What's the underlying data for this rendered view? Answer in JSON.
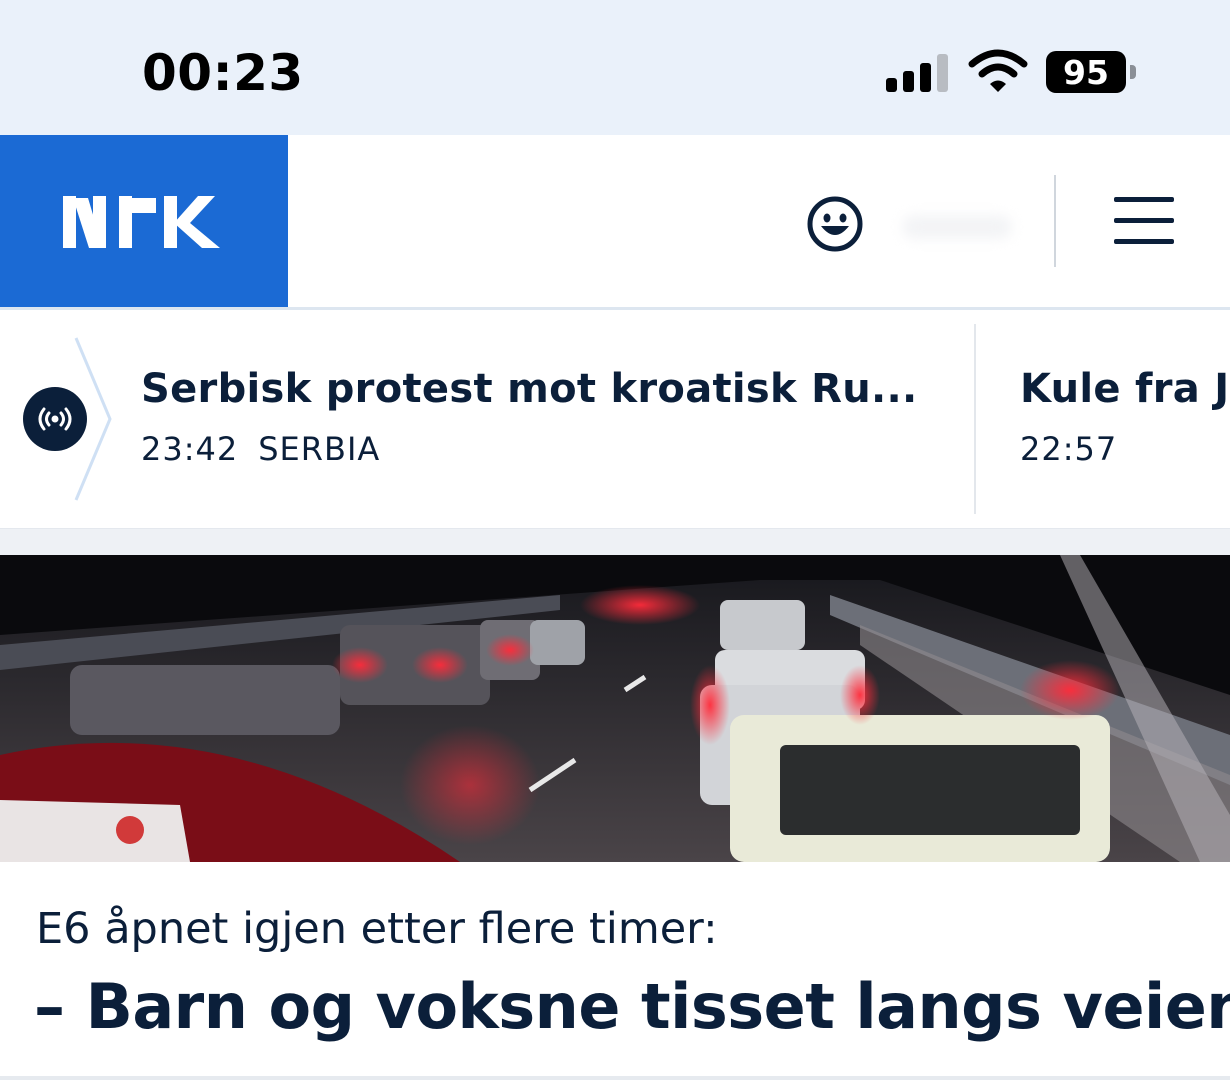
{
  "status_bar": {
    "time": "00:23",
    "battery": "95",
    "icons": [
      "cellular-signal-icon",
      "wifi-icon",
      "battery-icon"
    ]
  },
  "header": {
    "logo": "nrk",
    "icons": [
      "smiley-icon",
      "menu-icon"
    ],
    "colors": {
      "logo_background": "#1b6ad4",
      "text": "#0b1f3a"
    }
  },
  "ticker": {
    "icon": "live-broadcast-icon",
    "items": [
      {
        "title": "Serbisk protest mot kroatisk Ru...",
        "time": "23:42",
        "category": "SERBIA"
      },
      {
        "title": "Kule fra Jo",
        "time": "22:57",
        "category": ""
      }
    ]
  },
  "article": {
    "kicker": "E6 åpnet igjen etter flere timer:",
    "headline": "– Barn og voksne tisset langs veien"
  }
}
